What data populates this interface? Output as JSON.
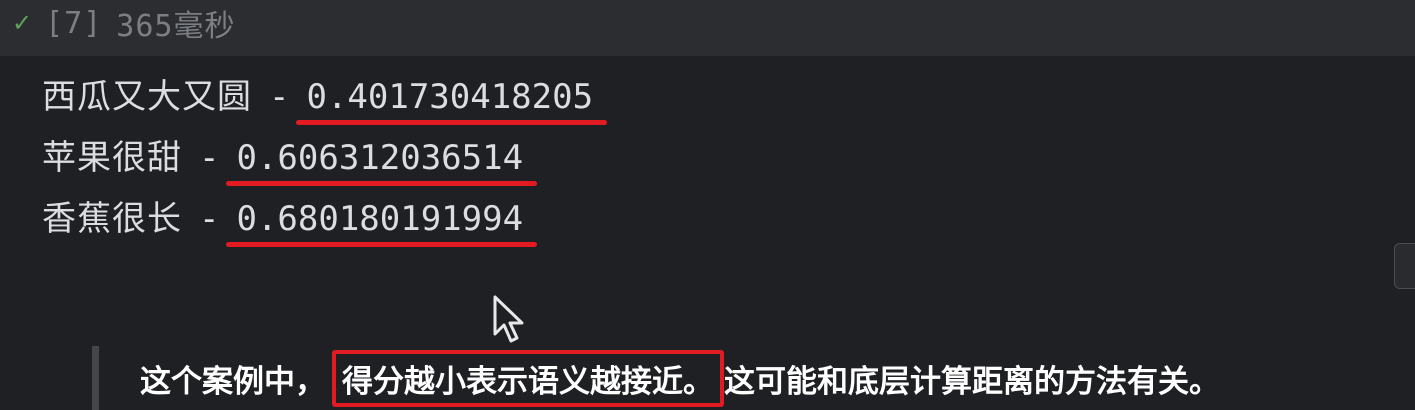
{
  "cell": {
    "status_icon": "check-icon",
    "exec_count": "[7]",
    "duration": "365毫秒"
  },
  "output": {
    "separator": "-",
    "lines": [
      {
        "label": "西瓜又大又圆",
        "score": "0.401730418205"
      },
      {
        "label": "苹果很甜",
        "score": "0.606312036514"
      },
      {
        "label": "香蕉很长",
        "score": "0.680180191994"
      }
    ]
  },
  "caption": {
    "prefix": "这个案例中，",
    "highlight": "得分越小表示语义越接近。",
    "suffix": "这可能和底层计算距离的方法有关。"
  },
  "colors": {
    "background": "#1f2023",
    "header": "#2b2d30",
    "success": "#5fa35b",
    "annotation_red": "#e21b22"
  }
}
